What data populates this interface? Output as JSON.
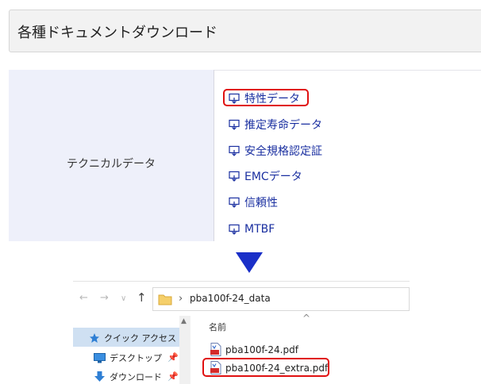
{
  "header": {
    "title": "各種ドキュメントダウンロード"
  },
  "category": {
    "label": "テクニカルデータ"
  },
  "links": [
    {
      "label": "特性データ",
      "highlighted": true
    },
    {
      "label": "推定寿命データ"
    },
    {
      "label": "安全規格認定証"
    },
    {
      "label": "EMCデータ"
    },
    {
      "label": "信頼性"
    },
    {
      "label": "MTBF"
    }
  ],
  "explorer": {
    "address": {
      "folder_name": "pba100f-24_data"
    },
    "sidebar": [
      {
        "label": "クイック アクセス",
        "icon": "star-icon",
        "selected": true
      },
      {
        "label": "デスクトップ",
        "icon": "desktop-icon",
        "pinned": true
      },
      {
        "label": "ダウンロード",
        "icon": "download-icon",
        "pinned": true
      }
    ],
    "column_header": "名前",
    "files": [
      {
        "name": "pba100f-24.pdf",
        "icon": "pdf-file-icon"
      },
      {
        "name": "pba100f-24_extra.pdf",
        "icon": "pdf-file-icon",
        "highlighted": true
      }
    ]
  },
  "colors": {
    "link": "#1a2fa0",
    "highlight": "#e01010",
    "arrow": "#1a2fc8",
    "category_bg": "#eef0fa",
    "selection": "#cfe0f2"
  }
}
